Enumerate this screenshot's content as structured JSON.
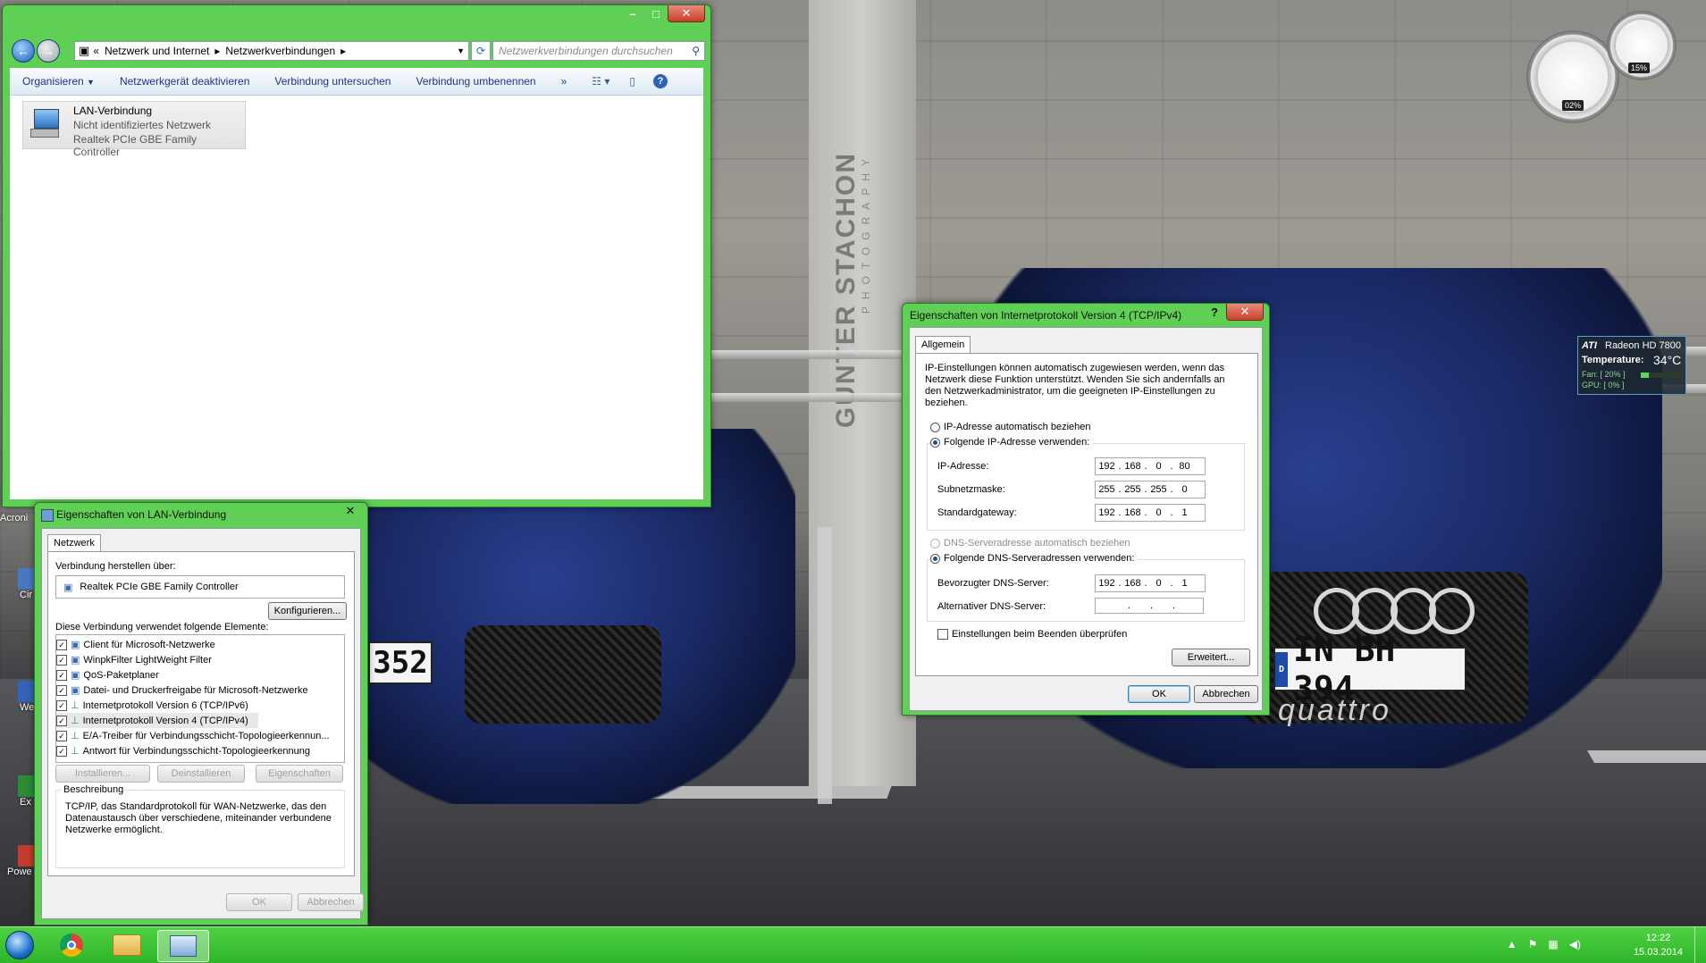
{
  "explorer": {
    "breadcrumb": [
      "«",
      "Netzwerk und Internet",
      "Netzwerkverbindungen"
    ],
    "search_placeholder": "Netzwerkverbindungen durchsuchen",
    "toolbar": [
      "Organisieren",
      "Netzwerkgerät deaktivieren",
      "Verbindung untersuchen",
      "Verbindung umbenennen",
      "»"
    ],
    "item": {
      "name": "LAN-Verbindung",
      "status": "Nicht identifiziertes Netzwerk",
      "adapter": "Realtek PCIe GBE Family Controller"
    }
  },
  "lan_dialog": {
    "title": "Eigenschaften von LAN-Verbindung",
    "tab": "Netzwerk",
    "connect_label": "Verbindung herstellen über:",
    "adapter": "Realtek PCIe GBE Family Controller",
    "configure": "Konfigurieren...",
    "elements_label": "Diese Verbindung verwendet folgende Elemente:",
    "items": [
      "Client für Microsoft-Netzwerke",
      "WinpkFilter LightWeight Filter",
      "QoS-Paketplaner",
      "Datei- und Druckerfreigabe für Microsoft-Netzwerke",
      "Internetprotokoll Version 6 (TCP/IPv6)",
      "Internetprotokoll Version 4 (TCP/IPv4)",
      "E/A-Treiber für Verbindungsschicht-Topologieerkennun...",
      "Antwort für Verbindungsschicht-Topologieerkennung"
    ],
    "install": "Installieren...",
    "uninstall": "Deinstallieren",
    "properties": "Eigenschaften",
    "description_label": "Beschreibung",
    "description": "TCP/IP, das Standardprotokoll für WAN-Netzwerke, das den Datenaustausch über verschiedene, miteinander verbundene Netzwerke ermöglicht.",
    "ok": "OK",
    "cancel": "Abbrechen"
  },
  "ipv4_dialog": {
    "title": "Eigenschaften von Internetprotokoll Version 4 (TCP/IPv4)",
    "help": "?",
    "tab": "Allgemein",
    "intro": "IP-Einstellungen können automatisch zugewiesen werden, wenn das Netzwerk diese Funktion unterstützt. Wenden Sie sich andernfalls an den Netzwerkadministrator, um die geeigneten IP-Einstellungen zu beziehen.",
    "ip_auto": "IP-Adresse automatisch beziehen",
    "ip_manual": "Folgende IP-Adresse verwenden:",
    "ip_label": "IP-Adresse:",
    "ip": [
      "192",
      "168",
      "0",
      "80"
    ],
    "mask_label": "Subnetzmaske:",
    "mask": [
      "255",
      "255",
      "255",
      "0"
    ],
    "gw_label": "Standardgateway:",
    "gw": [
      "192",
      "168",
      "0",
      "1"
    ],
    "dns_auto": "DNS-Serveradresse automatisch beziehen",
    "dns_manual": "Folgende DNS-Serveradressen verwenden:",
    "dns1_label": "Bevorzugter DNS-Server:",
    "dns1": [
      "192",
      "168",
      "0",
      "1"
    ],
    "dns2_label": "Alternativer DNS-Server:",
    "dns2": [
      ".",
      ".",
      "."
    ],
    "validate": "Einstellungen beim Beenden überprüfen",
    "advanced": "Erweitert...",
    "ok": "OK",
    "cancel": "Abbrechen"
  },
  "gadgets": {
    "cpu": "02%",
    "mem": "15%",
    "gpu_brand": "ATI",
    "gpu_name": "Radeon HD 7800",
    "temp_label": "Temperature:",
    "temp": "34°C",
    "fan": "Fan: [ 20% ]",
    "gpu_load": "GPU: [ 0% ]"
  },
  "wallpaper": {
    "brand": "GUNTER STACHON",
    "brand_sub": "PHOTOGRAPHY",
    "plate_left": "352",
    "plate_right": "IN BH 394",
    "plate_country": "D",
    "quattro": "quattro"
  },
  "desktop_icons": [
    "Acroni",
    "Cir",
    "We",
    "Ex",
    "Powe"
  ],
  "taskbar": {
    "time": "12:22",
    "date": "15.03.2014"
  }
}
